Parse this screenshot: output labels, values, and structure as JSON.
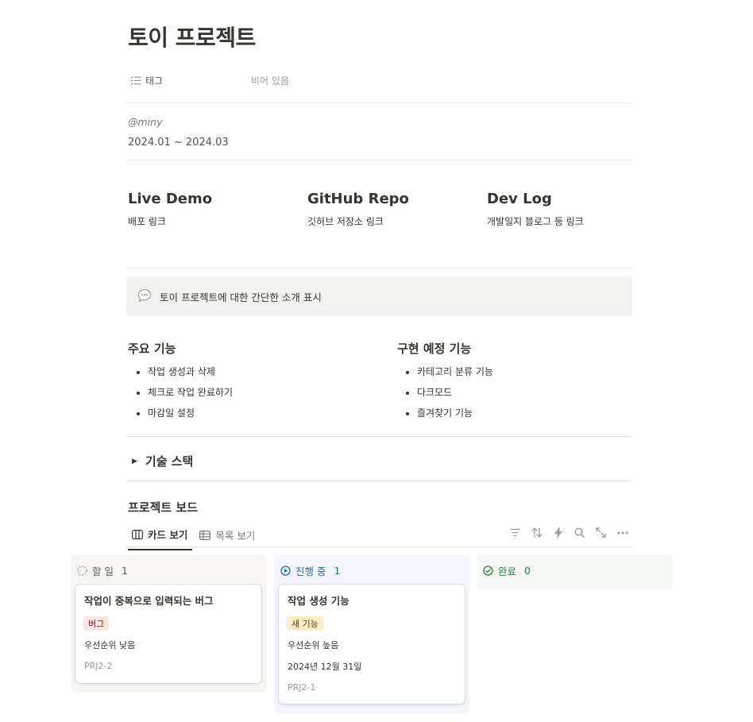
{
  "page": {
    "title": "토이 프로젝트"
  },
  "properties": {
    "tag_label": "태그",
    "tag_value": "비어 있음"
  },
  "info": {
    "author": "@miny",
    "period": "2024.01 ~ 2024.03"
  },
  "links": [
    {
      "title": "Live Demo",
      "subtitle": "배포 링크"
    },
    {
      "title": "GitHub Repo",
      "subtitle": "깃허브 저장소 링크"
    },
    {
      "title": "Dev Log",
      "subtitle": "개발일지 블로그 등 링크"
    }
  ],
  "callout": {
    "icon": "speech-bubble-icon",
    "text": "토이 프로젝트에 대한 간단한 소개 표시"
  },
  "features": {
    "main": {
      "title": "주요 기능",
      "items": [
        "작업 생성과 삭제",
        "체크로 작업 완료하기",
        "마감일 설정"
      ]
    },
    "planned": {
      "title": "구현 예정 기능",
      "items": [
        "카테고리 분류 기능",
        "다크모드",
        "즐겨찾기 기능"
      ]
    }
  },
  "toggle": {
    "title": "기술 스택"
  },
  "board": {
    "title": "프로젝트 보드",
    "tabs": [
      {
        "label": "카드 보기",
        "active": true
      },
      {
        "label": "목록 보기",
        "active": false
      }
    ],
    "toolbar": [
      "filter-icon",
      "sort-icon",
      "automation-icon",
      "search-icon",
      "expand-icon",
      "more-icon"
    ],
    "columns": [
      {
        "name": "할 일",
        "count": "1",
        "color": "#5f5e5b",
        "bg": "#f7f6f3",
        "cards": [
          {
            "title": "작업이 중복으로 입력되는 버그",
            "tag": "버그",
            "tag_bg": "#fbe4e4",
            "tag_color": "#5d1715",
            "priority": "우선순위 낮음",
            "id": "PRJ2-2"
          }
        ]
      },
      {
        "name": "진행 중",
        "count": "1",
        "color": "#2e6aa0",
        "bg": "#f3f7fb",
        "cards": [
          {
            "title": "작업 생성 기능",
            "tag": "새 기능",
            "tag_bg": "#fdecc8",
            "tag_color": "#5a3f10",
            "priority": "우선순위 높음",
            "date": "2024년 12월 31일",
            "id": "PRJ2-1"
          }
        ]
      },
      {
        "name": "완료",
        "count": "0",
        "color": "#2f7a4a",
        "bg": "#f3f8f4",
        "cards": []
      }
    ]
  }
}
